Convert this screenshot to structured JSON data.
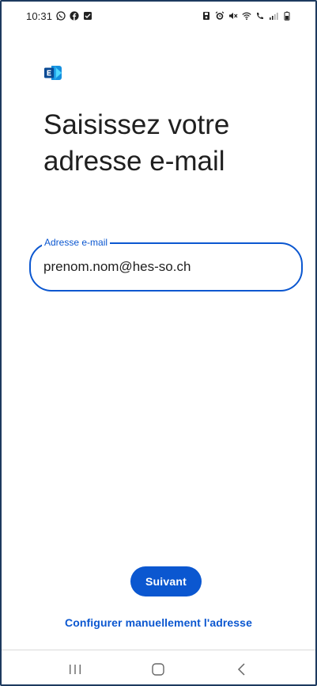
{
  "status_bar": {
    "time": "10:31",
    "left_icons": [
      "whatsapp-icon",
      "facebook-icon",
      "checkbox-icon"
    ],
    "right_icons": [
      "save-icon",
      "alarm-icon",
      "mute-icon",
      "wifi-icon",
      "call-icon",
      "signal-icon",
      "battery-icon"
    ]
  },
  "app": {
    "logo": "exchange-logo-icon"
  },
  "heading": {
    "line1": "Saisissez votre",
    "line2": "adresse e-mail"
  },
  "email_field": {
    "label": "Adresse e-mail",
    "value": "prenom.nom@hes-so.ch"
  },
  "actions": {
    "next_label": "Suivant",
    "manual_config_label": "Configurer manuellement l'adresse"
  },
  "nav_bar": {
    "recents": "recents-icon",
    "home": "home-icon",
    "back": "back-icon"
  },
  "colors": {
    "accent": "#0b57d0",
    "text": "#1f1f1f",
    "frame": "#1d3a5f"
  }
}
